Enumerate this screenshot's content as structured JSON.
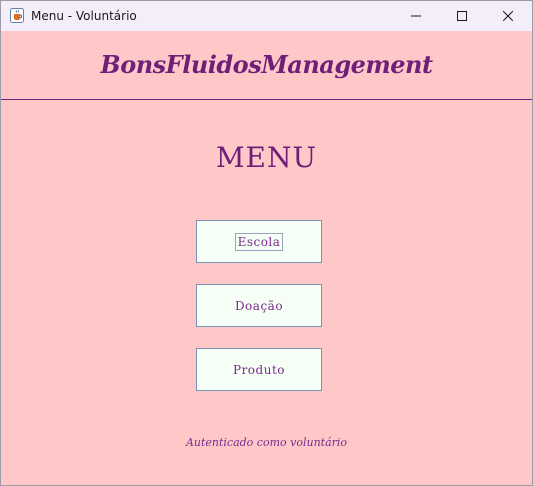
{
  "window": {
    "title": "Menu - Voluntário",
    "icon": "java-cup-icon",
    "controls": [
      "minimize-icon",
      "maximize-icon",
      "close-icon"
    ]
  },
  "header": {
    "brand": "BonsFluidosManagement"
  },
  "main": {
    "title": "MENU",
    "buttons": [
      {
        "label": "Escola",
        "focused": true
      },
      {
        "label": "Doação",
        "focused": false
      },
      {
        "label": "Produto",
        "focused": false
      }
    ]
  },
  "footer": {
    "status": "Autenticado como voluntário"
  },
  "colors": {
    "background": "#ffc8c8",
    "accent": "#6f1f78",
    "button_bg": "#f5fff5",
    "button_border": "#7a90b4",
    "titlebar": "#f3eefa"
  }
}
